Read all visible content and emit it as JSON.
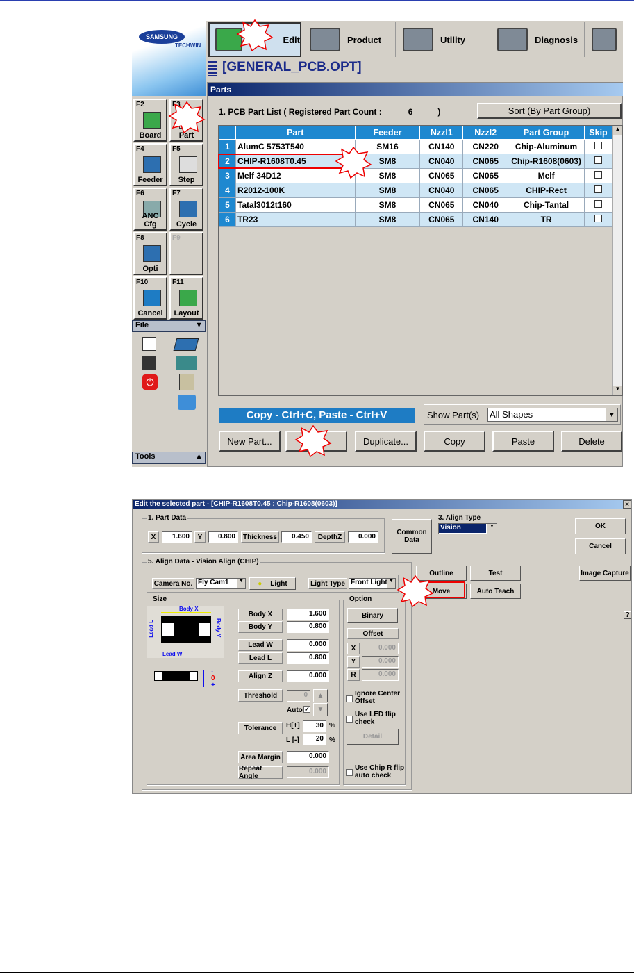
{
  "toolbar": {
    "edit": "Edit",
    "product": "Product",
    "utility": "Utility",
    "diagnosis": "Diagnosis"
  },
  "logo": {
    "brand": "SAMSUNG",
    "sub": "TECHWIN"
  },
  "file_title": "[GENERAL_PCB.OPT]",
  "panel_title": "Parts",
  "fkeys": [
    {
      "key": "F2",
      "label": "Board"
    },
    {
      "key": "F3",
      "label": "Part"
    },
    {
      "key": "F4",
      "label": "Feeder"
    },
    {
      "key": "F5",
      "label": "Step"
    },
    {
      "key": "F6",
      "label": "ANC Cfg"
    },
    {
      "key": "F7",
      "label": "Cycle"
    },
    {
      "key": "F8",
      "label": "Opti"
    },
    {
      "key": "F9",
      "label": ""
    },
    {
      "key": "F10",
      "label": "Cancel"
    },
    {
      "key": "F11",
      "label": "Layout"
    }
  ],
  "file_menu": "File",
  "tools_menu": "Tools",
  "list_heading": "1. PCB Part List  ( Registered Part Count :",
  "part_count": "6",
  "list_heading_end": ")",
  "sort_button": "Sort (By Part Group)",
  "columns": [
    "",
    "Part",
    "Feeder",
    "Nzzl1",
    "Nzzl2",
    "Part Group",
    "Skip"
  ],
  "rows": [
    {
      "n": "1",
      "part": "AlumC 5753T540",
      "feeder": "SM16",
      "n1": "CN140",
      "n2": "CN220",
      "group": "Chip-Aluminum"
    },
    {
      "n": "2",
      "part": "CHIP-R1608T0.45",
      "feeder": "SM8",
      "n1": "CN040",
      "n2": "CN065",
      "group": "Chip-R1608(0603)"
    },
    {
      "n": "3",
      "part": "Melf 34D12",
      "feeder": "SM8",
      "n1": "CN065",
      "n2": "CN065",
      "group": "Melf"
    },
    {
      "n": "4",
      "part": "R2012-100K",
      "feeder": "SM8",
      "n1": "CN040",
      "n2": "CN065",
      "group": "CHIP-Rect"
    },
    {
      "n": "5",
      "part": "Tatal3012t160",
      "feeder": "SM8",
      "n1": "CN065",
      "n2": "CN040",
      "group": "Chip-Tantal"
    },
    {
      "n": "6",
      "part": "TR23",
      "feeder": "SM8",
      "n1": "CN065",
      "n2": "CN140",
      "group": "TR"
    }
  ],
  "copy_hint": "Copy - Ctrl+C,  Paste - Ctrl+V",
  "show_parts_label": "Show Part(s)",
  "show_parts_value": "All Shapes",
  "buttons": {
    "new_part": "New Part...",
    "edit": "",
    "duplicate": "Duplicate...",
    "copy": "Copy",
    "paste": "Paste",
    "delete": "Delete"
  },
  "dialog": {
    "title": "Edit the selected part - [CHIP-R1608T0.45 : Chip-R1608(0603)]",
    "close": "×",
    "part_data_label": "1. Part Data",
    "x_label": "X",
    "x": "1.600",
    "y_label": "Y",
    "y": "0.800",
    "thickness_label": "Thickness",
    "thickness": "0.450",
    "depthz_label": "DepthZ",
    "depthz": "0.000",
    "common_data": "Common Data",
    "align_type_label": "3. Align Type",
    "align_type": "Vision",
    "ok": "OK",
    "cancel": "Cancel",
    "align_data_label": "5. Align Data - Vision Align (CHIP)",
    "camera_label": "Camera No.",
    "camera": "Fly Cam1",
    "light": "Light",
    "light_type_label": "Light Type",
    "light_type": "Front Light",
    "outline": "Outline",
    "test": "Test",
    "move": "Move",
    "auto_teach": "Auto Teach",
    "image_capture": "Image Capture",
    "help": "?",
    "size_label": "Size",
    "diagram": {
      "body_x": "Body X",
      "body_y": "Body Y",
      "lead_l": "Lead L",
      "lead_w": "Lead W",
      "minus": "-",
      "zero": "0",
      "plus": "+"
    },
    "body_x_label": "Body X",
    "body_x": "1.600",
    "body_y_label": "Body Y",
    "body_y": "0.800",
    "lead_w_label": "Lead W",
    "lead_w": "0.000",
    "lead_l_label": "Lead L",
    "lead_l": "0.800",
    "align_z_label": "Align Z",
    "align_z": "0.000",
    "threshold_label": "Threshold",
    "threshold": "0",
    "auto_label": "Auto",
    "tolerance_label": "Tolerance",
    "h_label": "H[+]",
    "h": "30",
    "l_label": "L [-]",
    "l": "20",
    "pct": "%",
    "area_margin_label": "Area Margin",
    "area_margin": "0.000",
    "repeat_angle_label": "Repeat Angle",
    "repeat_angle": "0.000",
    "option_label": "Option",
    "binary": "Binary",
    "offset": "Offset",
    "off_x_label": "X",
    "off_x": "0.000",
    "off_y_label": "Y",
    "off_y": "0.000",
    "off_r_label": "R",
    "off_r": "0.000",
    "ignore_center": "Ignore Center Offset",
    "use_led": "Use LED flip check",
    "detail": "Detail",
    "use_chip": "Use Chip R flip auto check"
  }
}
